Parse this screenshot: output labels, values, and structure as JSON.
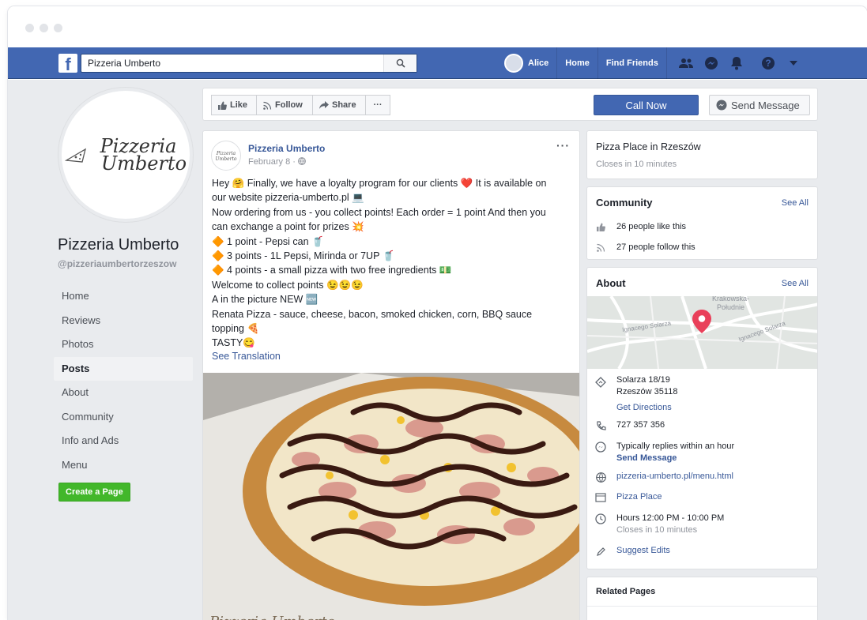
{
  "window": {
    "dot_colors": [
      "#e2e4e8",
      "#e2e4e8",
      "#e2e4e8"
    ]
  },
  "topbar": {
    "logo_letter": "f",
    "search_value": "Pizzeria Umberto",
    "user_name": "Alice",
    "links": [
      "Home",
      "Find Friends"
    ],
    "icons": [
      "friends-icon",
      "messenger-icon",
      "notifications-icon",
      "help-icon",
      "dropdown-caret-icon"
    ],
    "accent": "#4267b2"
  },
  "profile": {
    "logo_line1": "Pizzeria",
    "logo_line2": "Umberto",
    "name": "Pizzeria Umberto",
    "handle": "@pizzeriaumbertorzeszow",
    "nav": [
      "Home",
      "Reviews",
      "Photos",
      "Posts",
      "About",
      "Community",
      "Info and Ads",
      "Menu"
    ],
    "active_nav": "Posts",
    "create_page": "Create a Page"
  },
  "actions": {
    "like": "Like",
    "follow": "Follow",
    "share": "Share",
    "more": "···",
    "call_now": "Call Now",
    "send_message": "Send Message"
  },
  "post": {
    "author": "Pizzeria Umberto",
    "date": "February 8 · ",
    "more": "···",
    "lines": [
      "Hey 🤗 Finally, we have a loyalty program for our clients ❤️ It is available on",
      "our website pizzeria-umberto.pl 💻",
      "Now ordering from us - you collect points! Each order = 1 point And then you",
      "can exchange a point for prizes 💥",
      "🔶 1 point - Pepsi can 🥤",
      "🔶 3 points - 1L Pepsi, Mirinda or 7UP 🥤",
      "🔶 4 points - a small pizza with two free ingredients 💵",
      "Welcome to collect points 😉😉😉",
      "A in the picture NEW 🆕",
      "Renata Pizza - sauce, cheese, bacon, smoked chicken, corn, BBQ sauce",
      "topping 🍕",
      "TASTY😋"
    ],
    "see_translation": "See Translation",
    "image_caption": "Pizzeria Umberto"
  },
  "sidebar": {
    "category": "Pizza Place in Rzeszów",
    "closes": "Closes in 10 minutes",
    "community": {
      "title": "Community",
      "see_all": "See All",
      "likes": "26 people like this",
      "follows": "27 people follow this"
    },
    "about": {
      "title": "About",
      "see_all": "See All",
      "map_labels": [
        "Krakowska-",
        "Południe",
        "Ignacego Solarza",
        "Ignacego Solarza"
      ],
      "address1": "Solarza 18/19",
      "address2": "Rzeszów 35118",
      "directions": "Get Directions",
      "phone": "727 357 356",
      "replies": "Typically replies within an hour",
      "send_message": "Send Message",
      "website": "pizzeria-umberto.pl/menu.html",
      "category": "Pizza Place",
      "hours": "Hours 12:00 PM - 10:00 PM",
      "hours_closes": "Closes in 10 minutes",
      "suggest": "Suggest Edits"
    },
    "related": {
      "title": "Related Pages"
    }
  }
}
